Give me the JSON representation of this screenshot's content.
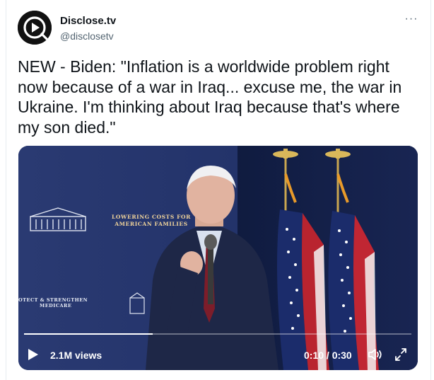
{
  "tweet": {
    "display_name": "Disclose.tv",
    "handle": "@disclosetv",
    "text": "NEW - Biden: \"Inflation is a worldwide problem right now because of a war in Iraq... excuse me, the war in Ukraine. I'm thinking about Iraq because that's where my son died.\"",
    "more_label": "···",
    "avatar_icon": "play-logo-icon"
  },
  "video": {
    "views": "2.1M views",
    "time": "0:10 / 0:30",
    "progress": 0.333,
    "sign_main_line1": "Lowering Costs For",
    "sign_main_line2": "American Families",
    "sign_left_line1": "otect & Strengthen",
    "sign_left_line2": "Medicare",
    "icons": {
      "play": "play-icon",
      "volume": "volume-icon",
      "fullscreen": "fullscreen-icon"
    }
  },
  "colors": {
    "text": "#0f1419",
    "secondary": "#536471",
    "backdrop": "#1c2a5a",
    "sign_gold": "#f1d49a"
  }
}
